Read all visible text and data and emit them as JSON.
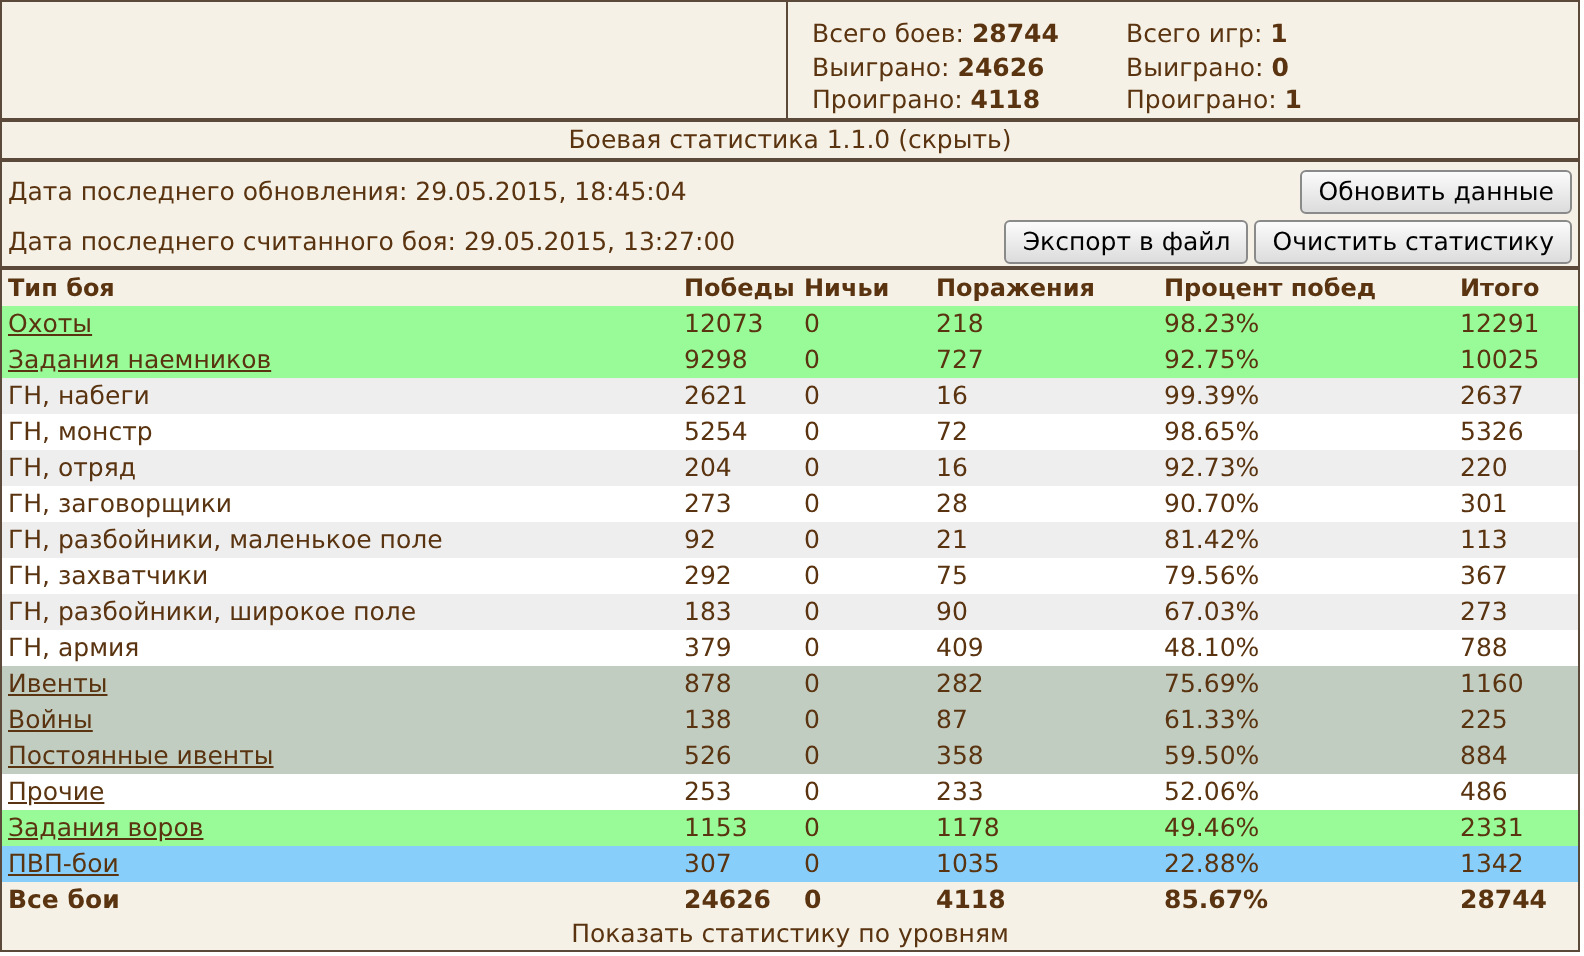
{
  "summary": {
    "battles": [
      {
        "label": "Всего боев:",
        "value": "28744"
      },
      {
        "label": "Выиграно:",
        "value": "24626"
      },
      {
        "label": "Проиграно:",
        "value": "4118"
      }
    ],
    "games": [
      {
        "label": "Всего игр:",
        "value": "1"
      },
      {
        "label": "Выиграно:",
        "value": "0"
      },
      {
        "label": "Проиграно:",
        "value": "1"
      }
    ]
  },
  "title": {
    "text": "Боевая статистика 1.1.0",
    "link": "(скрыть)"
  },
  "last_update": "Дата последнего обновления: 29.05.2015, 18:45:04",
  "last_battle": "Дата последнего считанного боя: 29.05.2015, 13:27:00",
  "buttons": {
    "refresh": "Обновить данные",
    "export": "Экспорт в файл",
    "clear": "Очистить статистику"
  },
  "table": {
    "columns": [
      "Тип боя",
      "Победы",
      "Ничьи",
      "Поражения",
      "Процент побед",
      "Итого"
    ],
    "rows": [
      {
        "cells": [
          "Охоты",
          "12073",
          "0",
          "218",
          "98.23%",
          "12291"
        ],
        "link": true,
        "color": "#98fb98"
      },
      {
        "cells": [
          "Задания наемников",
          "9298",
          "0",
          "727",
          "92.75%",
          "10025"
        ],
        "link": true,
        "color": "#98fb98"
      },
      {
        "cells": [
          "ГН, набеги",
          "2621",
          "0",
          "16",
          "99.39%",
          "2637"
        ],
        "link": false,
        "color": "#eeeeee"
      },
      {
        "cells": [
          "ГН, монстр",
          "5254",
          "0",
          "72",
          "98.65%",
          "5326"
        ],
        "link": false,
        "color": "#ffffff"
      },
      {
        "cells": [
          "ГН, отряд",
          "204",
          "0",
          "16",
          "92.73%",
          "220"
        ],
        "link": false,
        "color": "#eeeeee"
      },
      {
        "cells": [
          "ГН, заговорщики",
          "273",
          "0",
          "28",
          "90.70%",
          "301"
        ],
        "link": false,
        "color": "#ffffff"
      },
      {
        "cells": [
          "ГН, разбойники, маленькое поле",
          "92",
          "0",
          "21",
          "81.42%",
          "113"
        ],
        "link": false,
        "color": "#eeeeee"
      },
      {
        "cells": [
          "ГН, захватчики",
          "292",
          "0",
          "75",
          "79.56%",
          "367"
        ],
        "link": false,
        "color": "#ffffff"
      },
      {
        "cells": [
          "ГН, разбойники, широкое поле",
          "183",
          "0",
          "90",
          "67.03%",
          "273"
        ],
        "link": false,
        "color": "#eeeeee"
      },
      {
        "cells": [
          "ГН, армия",
          "379",
          "0",
          "409",
          "48.10%",
          "788"
        ],
        "link": false,
        "color": "#ffffff"
      },
      {
        "cells": [
          "Ивенты",
          "878",
          "0",
          "282",
          "75.69%",
          "1160"
        ],
        "link": true,
        "color": "#c2cdc2"
      },
      {
        "cells": [
          "Войны",
          "138",
          "0",
          "87",
          "61.33%",
          "225"
        ],
        "link": true,
        "color": "#c2cdc2"
      },
      {
        "cells": [
          "Постоянные ивенты",
          "526",
          "0",
          "358",
          "59.50%",
          "884"
        ],
        "link": true,
        "color": "#c2cdc2"
      },
      {
        "cells": [
          "Прочие",
          "253",
          "0",
          "233",
          "52.06%",
          "486"
        ],
        "link": true,
        "color": "#ffffff"
      },
      {
        "cells": [
          "Задания воров",
          "1153",
          "0",
          "1178",
          "49.46%",
          "2331"
        ],
        "link": true,
        "color": "#98fb98"
      },
      {
        "cells": [
          "ПВП-бои",
          "307",
          "0",
          "1035",
          "22.88%",
          "1342"
        ],
        "link": true,
        "color": "#87cefa"
      }
    ],
    "total": [
      "Все бои",
      "24626",
      "0",
      "4118",
      "85.67%",
      "28744"
    ]
  },
  "footer_link": "Показать статистику по уровням"
}
